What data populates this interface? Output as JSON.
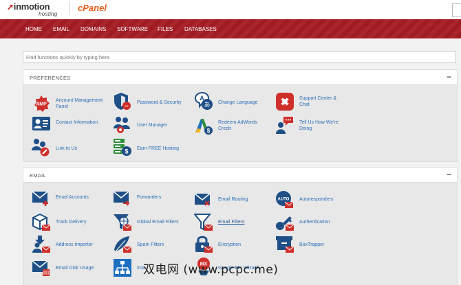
{
  "brand": {
    "logo_main": "inmotion",
    "logo_sub": "hosting",
    "cpanel": "cPanel"
  },
  "nav": [
    "HOME",
    "EMAIL",
    "DOMAINS",
    "SOFTWARE",
    "FILES",
    "DATABASES"
  ],
  "search": {
    "placeholder": "Find functions quickly by typing here."
  },
  "preferences": {
    "title": "PREFERENCES",
    "collapse": "−",
    "items": [
      {
        "label": "Account Management\nPanel",
        "icon": "amp-icon"
      },
      {
        "label": "Password & Security",
        "icon": "shield-lock-icon"
      },
      {
        "label": "Change Language",
        "icon": "language-icon"
      },
      {
        "label": "Support Center &\nChat",
        "icon": "support-lifebuoy-icon"
      },
      {
        "label": "Contact Information",
        "icon": "contact-card-icon"
      },
      {
        "label": "User Manager",
        "icon": "user-manager-icon"
      },
      {
        "label": "Redeem AdWords\nCredit",
        "icon": "adwords-icon"
      },
      {
        "label": "Tell Us How We're\nDoing",
        "icon": "feedback-icon"
      },
      {
        "label": "Link to Us",
        "icon": "link-users-icon"
      },
      {
        "label": "Earn FREE Hosting",
        "icon": "server-dollar-icon"
      }
    ]
  },
  "email": {
    "title": "EMAIL",
    "collapse": "−",
    "items": [
      {
        "label": "Email Accounts",
        "icon": "email-accounts-icon"
      },
      {
        "label": "Forwarders",
        "icon": "forwarders-icon"
      },
      {
        "label": "Email Routing",
        "icon": "email-routing-icon"
      },
      {
        "label": "Autoresponders",
        "icon": "autoresponders-icon"
      },
      {
        "label": "Track Delivery",
        "icon": "track-delivery-icon"
      },
      {
        "label": "Global Email Filters",
        "icon": "global-filters-icon"
      },
      {
        "label": "Email Filters",
        "icon": "email-filters-icon"
      },
      {
        "label": "Authentication",
        "icon": "authentication-key-icon"
      },
      {
        "label": "Address Importer",
        "icon": "address-importer-icon"
      },
      {
        "label": "Spam Filters",
        "icon": "spam-filters-icon"
      },
      {
        "label": "Encryption",
        "icon": "encryption-lock-icon"
      },
      {
        "label": "BoxTrapper",
        "icon": "boxtrapper-icon"
      },
      {
        "label": "Email Disk Usage",
        "icon": "email-disk-usage-icon"
      },
      {
        "label": "Ima",
        "icon": "imap-archive-icon"
      },
      {
        "label": "Google MX Wizard",
        "icon": "mx-wizard-icon"
      }
    ]
  },
  "watermark": "双电网 (www.pcpc.me)",
  "colors": {
    "nav_bg": "#a51c24",
    "link": "#2a6eb8",
    "icon_navy": "#1e4f86",
    "icon_red": "#d0302b"
  }
}
